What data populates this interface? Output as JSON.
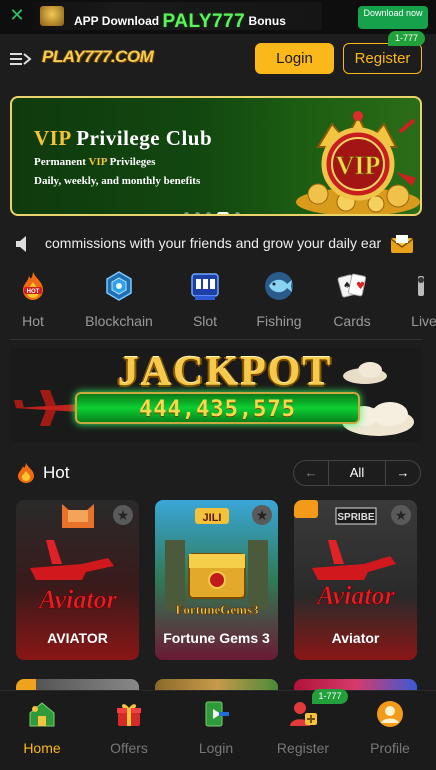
{
  "download_bar": {
    "prefix": "APP Download",
    "brand": "PALY777",
    "suffix": "Bonus",
    "button": "Download now"
  },
  "header": {
    "logo": "PLAY777.COM",
    "login": "Login",
    "register": "Register",
    "register_badge": "1-777"
  },
  "hero": {
    "title_vip": "VIP",
    "title_rest": " Privilege Club",
    "line1_pre": "Permanent ",
    "line1_vip": "VIP",
    "line1_post": " Privileges",
    "line2": "Daily, weekly, and monthly benefits",
    "slides": 6,
    "active_slide": 4
  },
  "marquee": {
    "text": "commissions with your friends and grow your daily earnings!"
  },
  "categories": [
    {
      "label": "Hot",
      "icon": "fire-icon"
    },
    {
      "label": "Blockchain",
      "icon": "blockchain-icon"
    },
    {
      "label": "Slot",
      "icon": "slot-icon"
    },
    {
      "label": "Fishing",
      "icon": "fish-icon"
    },
    {
      "label": "Cards",
      "icon": "cards-icon"
    },
    {
      "label": "Live",
      "icon": "live-icon"
    }
  ],
  "jackpot": {
    "title": "JACKPOT",
    "amount": "444,435,575"
  },
  "hot": {
    "title": "Hot",
    "pager_prev": "←",
    "pager_all": "All",
    "pager_next": "→",
    "games": [
      {
        "name": "AVIATOR",
        "provider": ""
      },
      {
        "name": "Fortune Gems 3",
        "provider": "JILI"
      },
      {
        "name": "Aviator",
        "provider": "SPRIBE"
      }
    ]
  },
  "bottom_nav": [
    {
      "label": "Home",
      "icon": "home-icon",
      "active": true
    },
    {
      "label": "Offers",
      "icon": "offers-icon",
      "active": false
    },
    {
      "label": "Login",
      "icon": "login-icon",
      "active": false
    },
    {
      "label": "Register",
      "icon": "register-icon",
      "active": false
    },
    {
      "label": "Profile",
      "icon": "profile-icon",
      "active": false
    }
  ],
  "nav_register_badge": "1-777",
  "colors": {
    "accent": "#fbb81a",
    "brand_green": "#22a03c",
    "background": "#1d1d1d"
  }
}
